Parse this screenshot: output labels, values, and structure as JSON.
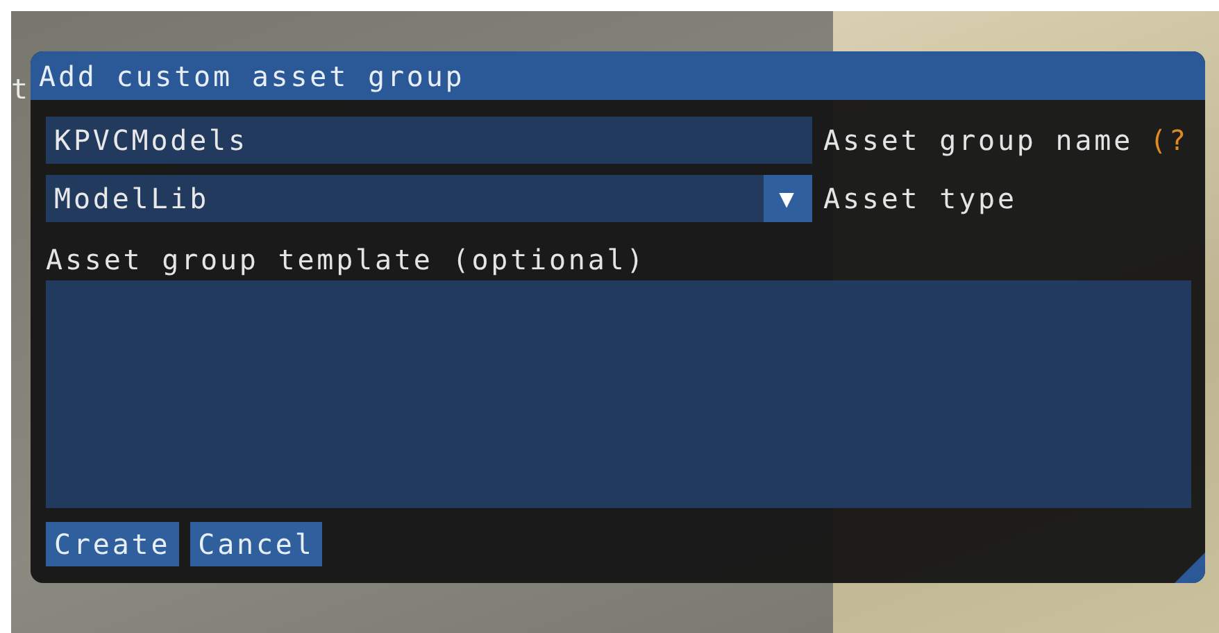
{
  "background": {
    "text": "t"
  },
  "dialog": {
    "title": "Add custom asset group",
    "name_field": {
      "value": "KPVCModels",
      "label": "Asset group name",
      "help": "(?"
    },
    "type_combo": {
      "value": "ModelLib",
      "label": "Asset type",
      "arrow": "▼"
    },
    "template": {
      "label": "Asset group template (optional)"
    },
    "buttons": [
      "Create",
      "Cancel"
    ]
  }
}
